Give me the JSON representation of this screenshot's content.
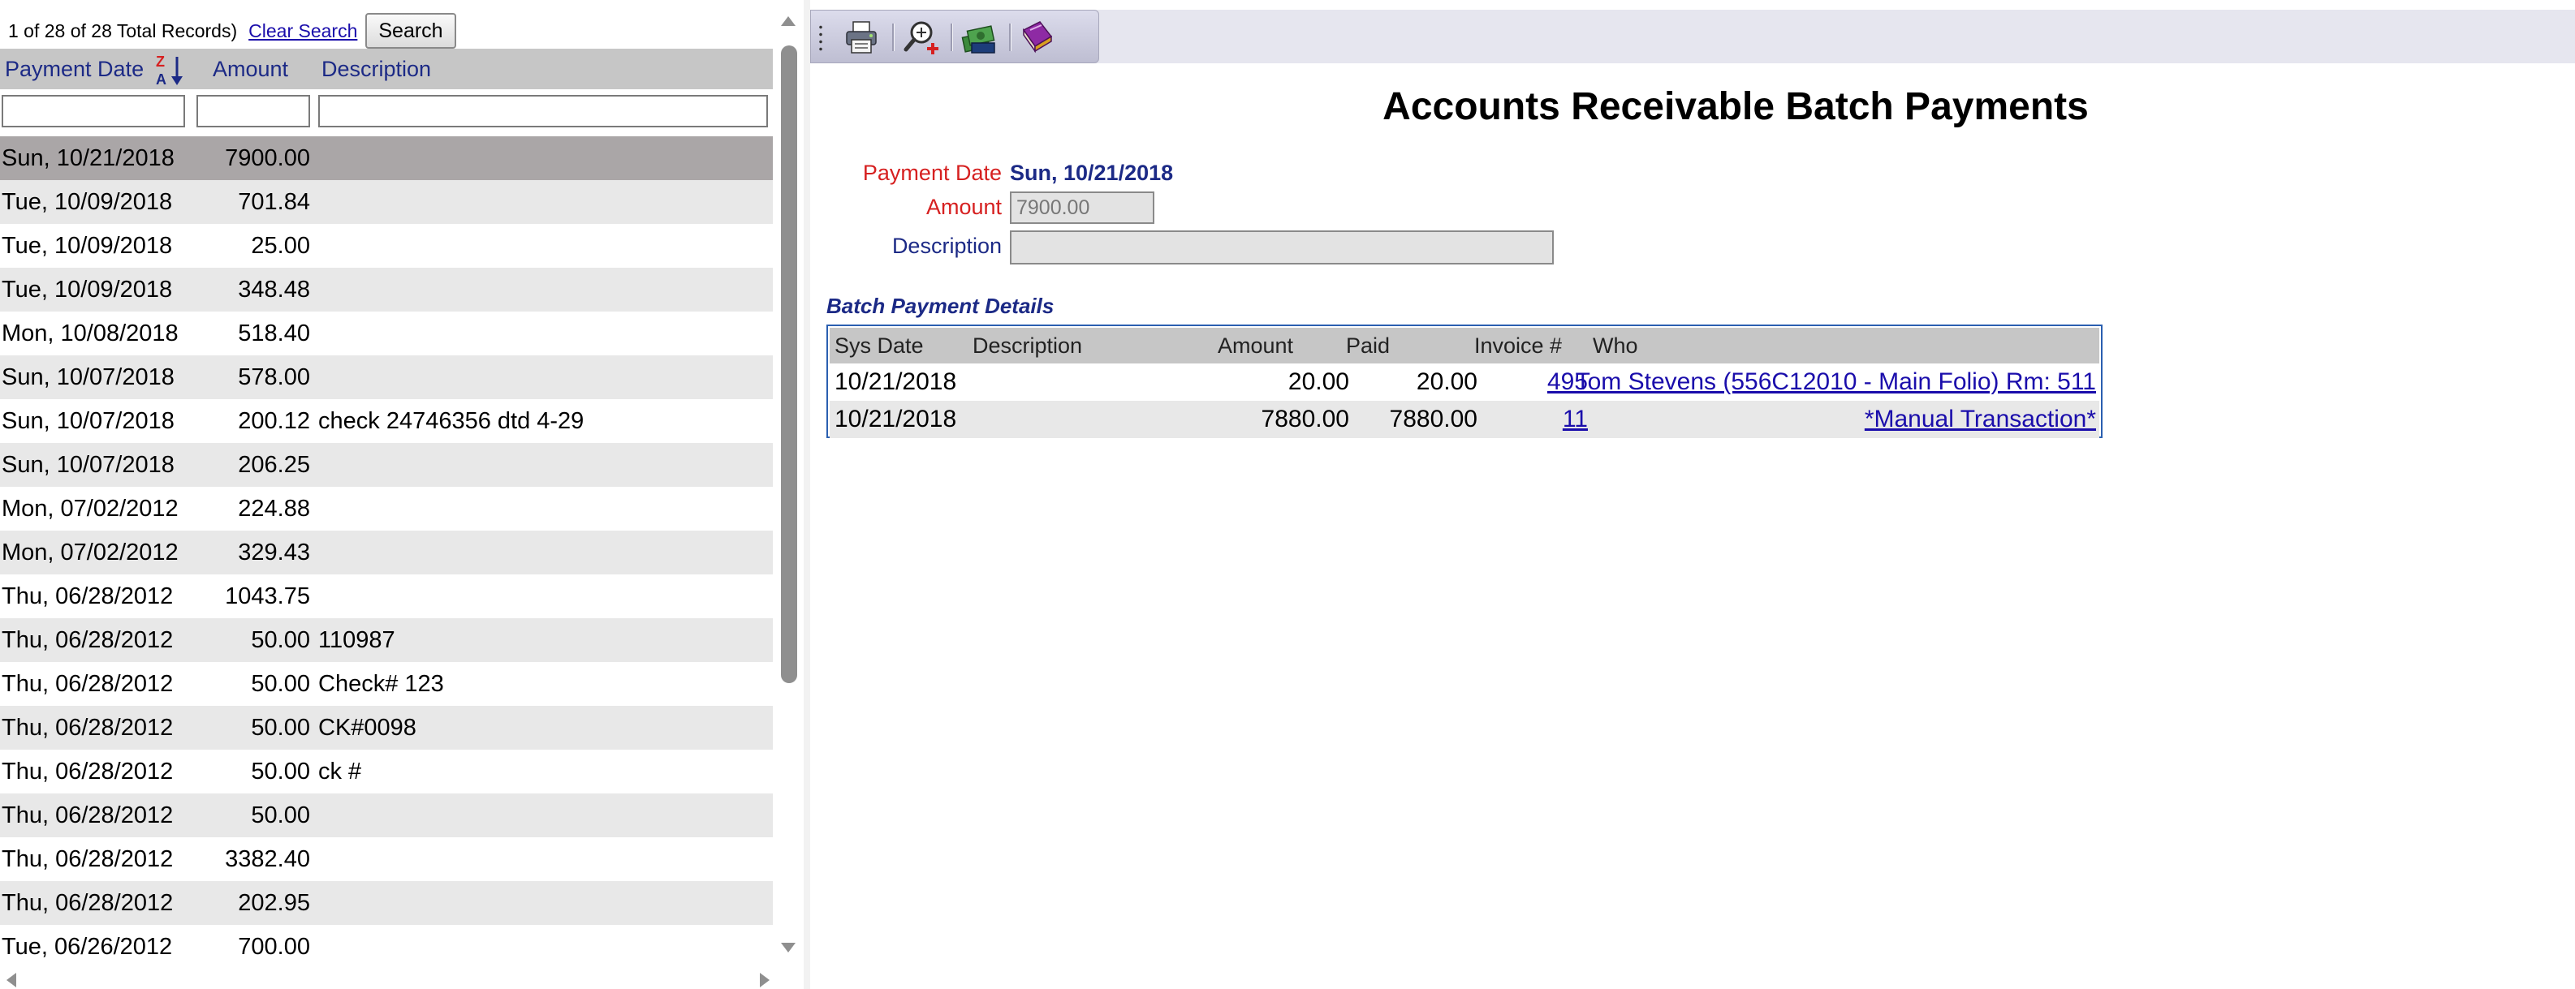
{
  "list": {
    "record_count": "1 of 28 of 28 Total Records)",
    "clear_search_label": "Clear Search",
    "search_button_label": "Search",
    "columns": {
      "payment_date": "Payment Date",
      "amount": "Amount",
      "description": "Description"
    },
    "filters": {
      "payment_date": "",
      "amount": "",
      "description": ""
    },
    "rows": [
      {
        "date": "Sun, 10/21/2018",
        "amount": "7900.00",
        "description": ""
      },
      {
        "date": "Tue, 10/09/2018",
        "amount": "701.84",
        "description": ""
      },
      {
        "date": "Tue, 10/09/2018",
        "amount": "25.00",
        "description": ""
      },
      {
        "date": "Tue, 10/09/2018",
        "amount": "348.48",
        "description": ""
      },
      {
        "date": "Mon, 10/08/2018",
        "amount": "518.40",
        "description": ""
      },
      {
        "date": "Sun, 10/07/2018",
        "amount": "578.00",
        "description": ""
      },
      {
        "date": "Sun, 10/07/2018",
        "amount": "200.12",
        "description": "check 24746356 dtd 4-29"
      },
      {
        "date": "Sun, 10/07/2018",
        "amount": "206.25",
        "description": ""
      },
      {
        "date": "Mon, 07/02/2012",
        "amount": "224.88",
        "description": ""
      },
      {
        "date": "Mon, 07/02/2012",
        "amount": "329.43",
        "description": ""
      },
      {
        "date": "Thu, 06/28/2012",
        "amount": "1043.75",
        "description": ""
      },
      {
        "date": "Thu, 06/28/2012",
        "amount": "50.00",
        "description": "110987"
      },
      {
        "date": "Thu, 06/28/2012",
        "amount": "50.00",
        "description": "Check# 123"
      },
      {
        "date": "Thu, 06/28/2012",
        "amount": "50.00",
        "description": "CK#0098"
      },
      {
        "date": "Thu, 06/28/2012",
        "amount": "50.00",
        "description": "ck #"
      },
      {
        "date": "Thu, 06/28/2012",
        "amount": "50.00",
        "description": ""
      },
      {
        "date": "Thu, 06/28/2012",
        "amount": "3382.40",
        "description": ""
      },
      {
        "date": "Thu, 06/28/2012",
        "amount": "202.95",
        "description": ""
      },
      {
        "date": "Tue, 06/26/2012",
        "amount": "700.00",
        "description": ""
      }
    ]
  },
  "toolbar": {
    "icons": [
      "print-icon",
      "zoom-add-icon",
      "cash-icon",
      "book-icon"
    ]
  },
  "form": {
    "title": "Accounts Receivable Batch Payments",
    "payment_date_label": "Payment Date",
    "payment_date_value": "Sun, 10/21/2018",
    "amount_label": "Amount",
    "amount_value": "7900.00",
    "description_label": "Description",
    "description_value": ""
  },
  "batch_details": {
    "title": "Batch Payment Details",
    "columns": {
      "sys_date": "Sys Date",
      "description": "Description",
      "amount": "Amount",
      "paid": "Paid",
      "invoice": "Invoice #",
      "who": "Who"
    },
    "rows": [
      {
        "sys_date": "10/21/2018",
        "description": "",
        "amount": "20.00",
        "paid": "20.00",
        "invoice": "495",
        "who": "Tom Stevens (556C12010 - Main Folio) Rm: 511"
      },
      {
        "sys_date": "10/21/2018",
        "description": "",
        "amount": "7880.00",
        "paid": "7880.00",
        "invoice": "11",
        "who": "*Manual Transaction*"
      }
    ]
  },
  "colors": {
    "label_required": "#d62020",
    "label_optional": "#1c2a86",
    "link": "#1a0dab",
    "selected_row": "#aaa6a7",
    "header_bg": "#c6c6c6"
  }
}
